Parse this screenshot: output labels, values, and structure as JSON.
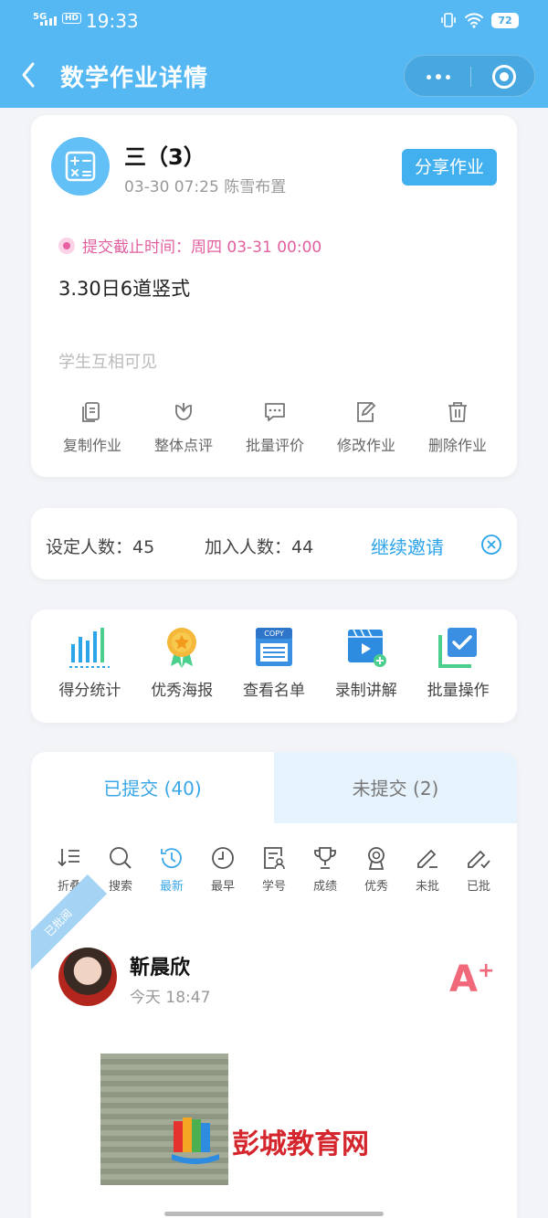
{
  "status_bar": {
    "network": "5G",
    "hd": "HD",
    "time": "19:33",
    "battery": "72"
  },
  "nav": {
    "title": "数学作业详情"
  },
  "assignment": {
    "class_name": "三（3）",
    "meta": "03-30 07:25 陈雪布置",
    "share_label": "分享作业",
    "deadline": "提交截止时间：周四 03-31 00:00",
    "content": "3.30日6道竖式",
    "visibility": "学生互相可见",
    "actions": [
      {
        "label": "复制作业",
        "icon": "copy-icon"
      },
      {
        "label": "整体点评",
        "icon": "flower-icon"
      },
      {
        "label": "批量评价",
        "icon": "comment-icon"
      },
      {
        "label": "修改作业",
        "icon": "edit-icon"
      },
      {
        "label": "删除作业",
        "icon": "trash-icon"
      }
    ]
  },
  "counts": {
    "set_label": "设定人数：45",
    "joined_label": "加入人数：44",
    "invite_label": "继续邀请"
  },
  "tools": [
    {
      "label": "得分统计",
      "icon": "bar-stats-icon"
    },
    {
      "label": "优秀海报",
      "icon": "medal-icon"
    },
    {
      "label": "查看名单",
      "icon": "copy-list-icon"
    },
    {
      "label": "录制讲解",
      "icon": "video-record-icon"
    },
    {
      "label": "批量操作",
      "icon": "batch-check-icon"
    }
  ],
  "submissions": {
    "tabs": [
      {
        "label": "已提交 (40)",
        "active": true
      },
      {
        "label": "未提交 (2)",
        "active": false
      }
    ],
    "filters": [
      {
        "label": "折叠",
        "icon": "collapse-icon"
      },
      {
        "label": "搜索",
        "icon": "search-icon"
      },
      {
        "label": "最新",
        "icon": "history-icon",
        "active": true
      },
      {
        "label": "最早",
        "icon": "clock-icon"
      },
      {
        "label": "学号",
        "icon": "student-id-icon"
      },
      {
        "label": "成绩",
        "icon": "trophy-icon"
      },
      {
        "label": "优秀",
        "icon": "badge-icon"
      },
      {
        "label": "未批",
        "icon": "pen-icon"
      },
      {
        "label": "已批",
        "icon": "pen-check-icon"
      }
    ],
    "entry": {
      "ribbon": "已批阅",
      "name": "靳晨欣",
      "time": "今天 18:47",
      "grade": "A",
      "grade_plus": "+"
    }
  },
  "watermark": {
    "text": "彭城教育网"
  },
  "colors": {
    "primary": "#55b8f3",
    "accent": "#3aa7e8",
    "deadline": "#e25f9f",
    "grade": "#f0687a"
  }
}
